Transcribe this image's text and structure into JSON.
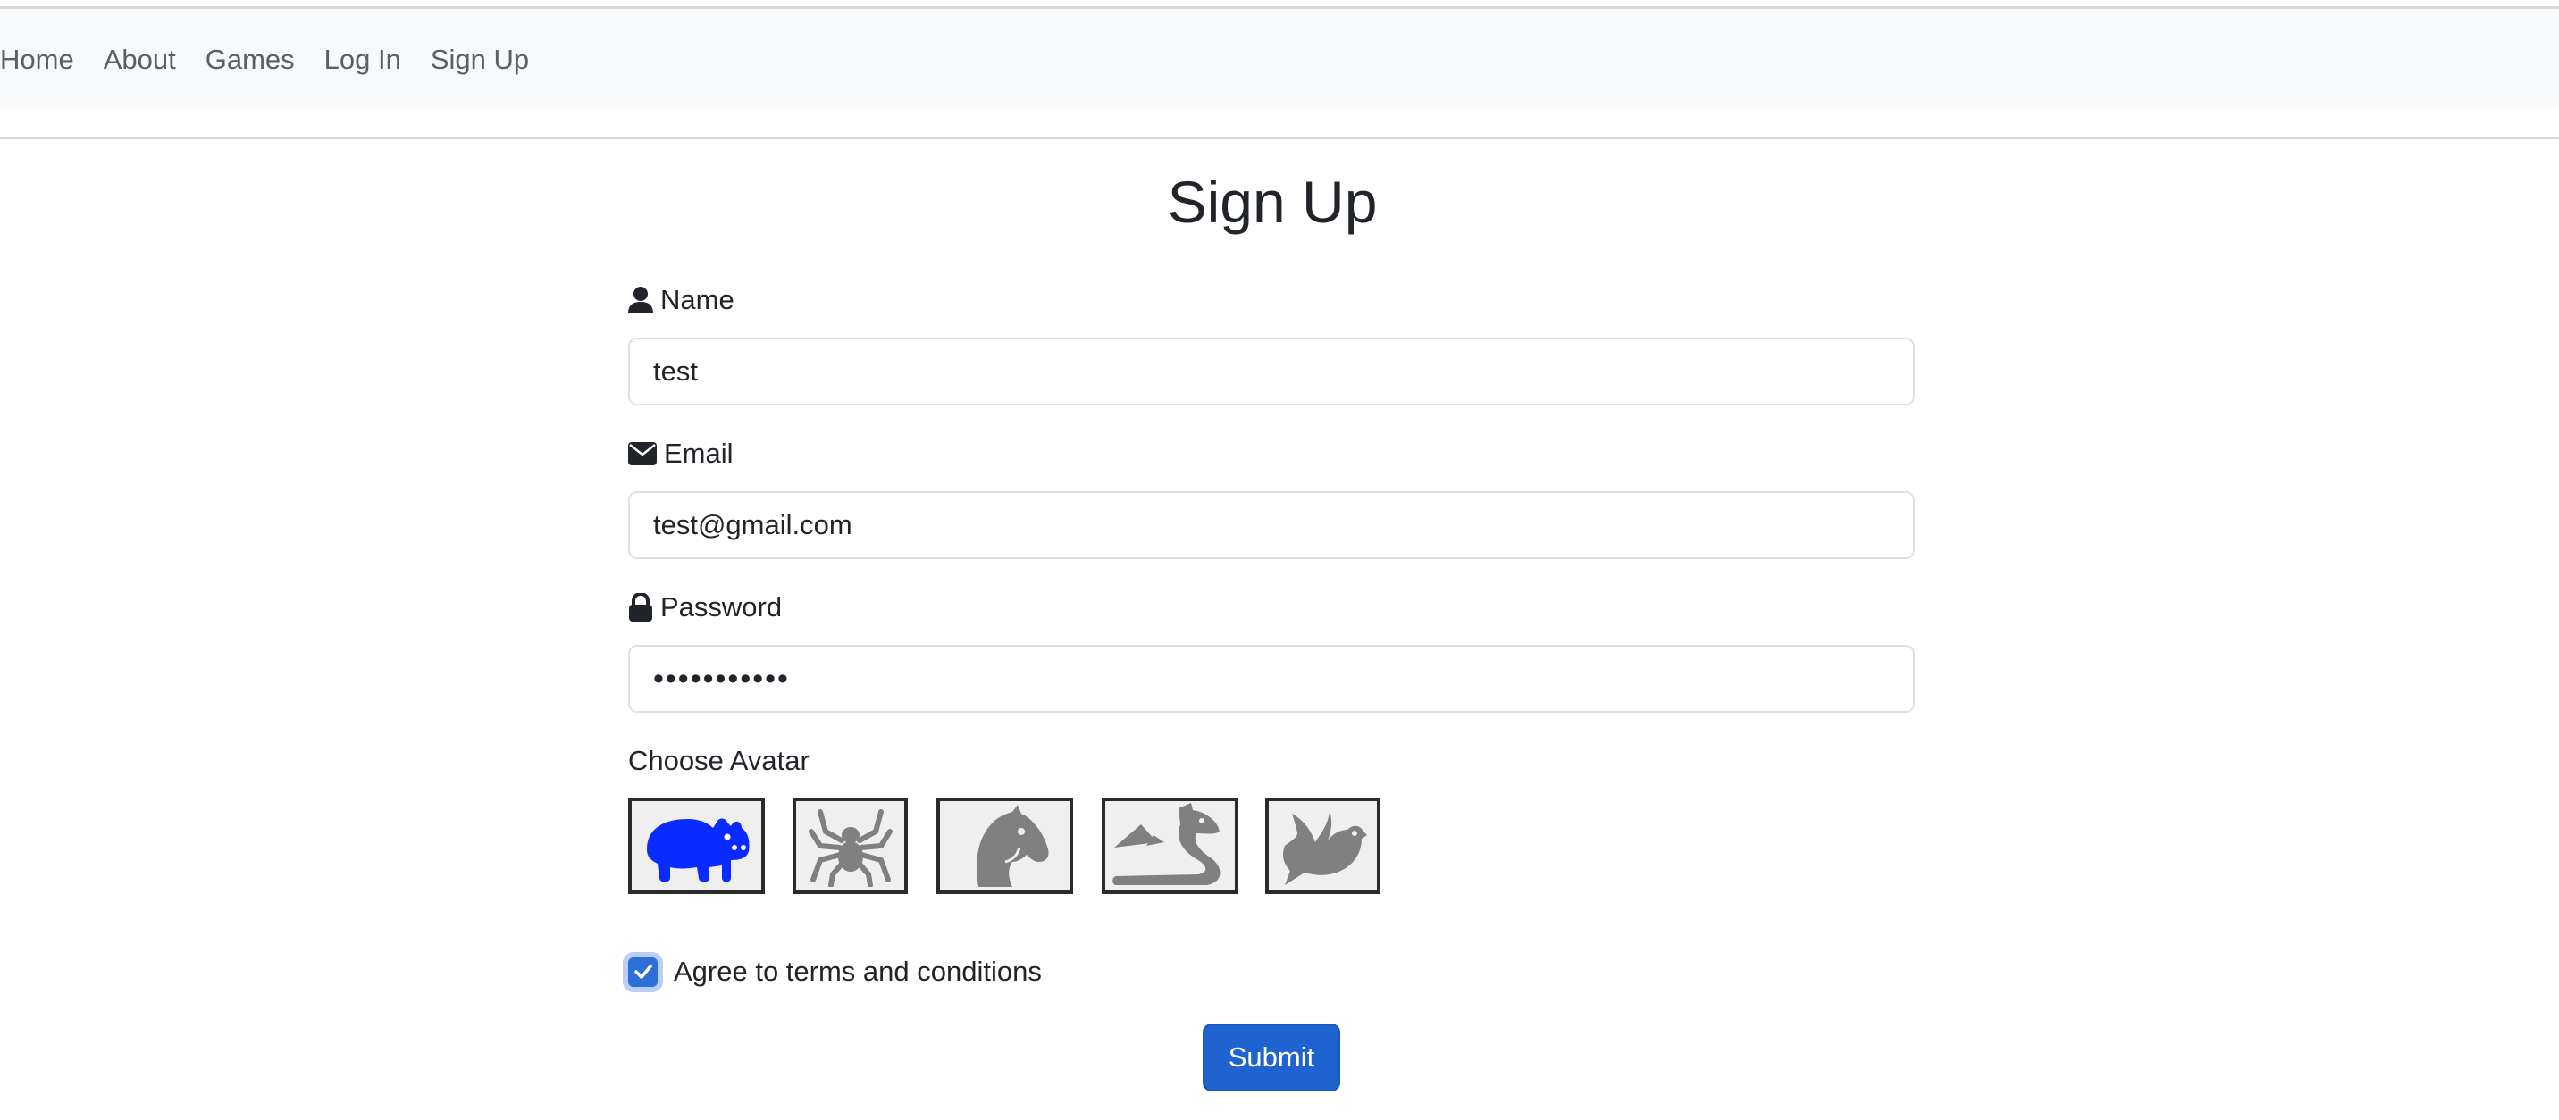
{
  "nav": {
    "items": [
      {
        "label": "Home"
      },
      {
        "label": "About"
      },
      {
        "label": "Games"
      },
      {
        "label": "Log In"
      },
      {
        "label": "Sign Up"
      }
    ]
  },
  "page": {
    "title": "Sign Up"
  },
  "form": {
    "name": {
      "label": "Name",
      "icon": "user-icon",
      "value": "test"
    },
    "email": {
      "label": "Email",
      "icon": "envelope-icon",
      "value": "test@gmail.com"
    },
    "password": {
      "label": "Password",
      "icon": "lock-icon",
      "value": "•••••••••••"
    },
    "avatar": {
      "label": "Choose Avatar",
      "options": [
        {
          "icon": "hippo-icon",
          "selected": true,
          "color": "#0a2bff"
        },
        {
          "icon": "spider-icon",
          "selected": false,
          "color": "#808080"
        },
        {
          "icon": "horse-head-icon",
          "selected": false,
          "color": "#808080"
        },
        {
          "icon": "dragon-icon",
          "selected": false,
          "color": "#808080"
        },
        {
          "icon": "dove-icon",
          "selected": false,
          "color": "#808080"
        }
      ]
    },
    "terms": {
      "label": "Agree to terms and conditions",
      "checked": true
    },
    "submit_label": "Submit"
  },
  "colors": {
    "primary": "#1f63d1",
    "selected_avatar": "#0a2bff",
    "unselected_avatar": "#808080",
    "navbar_bg": "#f8f9fa"
  }
}
